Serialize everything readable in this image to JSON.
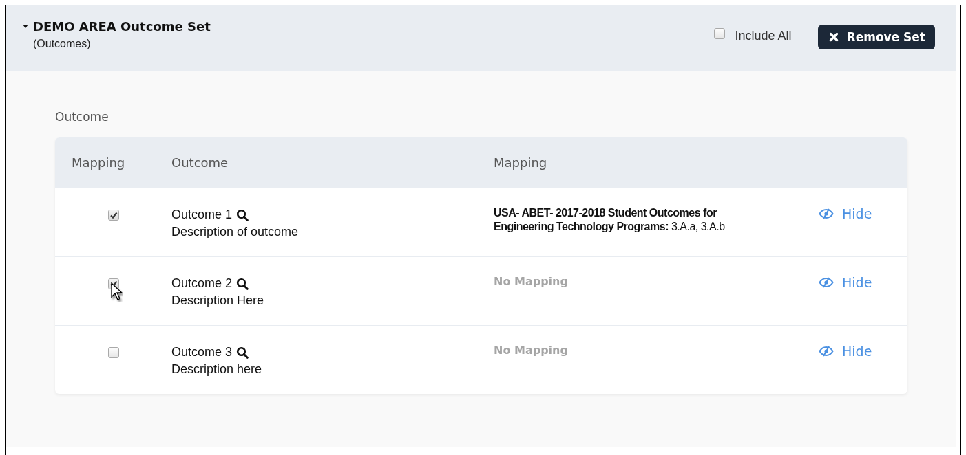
{
  "set": {
    "title": "DEMO AREA Outcome Set",
    "subtitle": "(Outcomes)",
    "expanded": true,
    "include_all": {
      "label": "Include All",
      "checked": false
    },
    "remove_button": "Remove Set"
  },
  "section_label": "Outcome",
  "table": {
    "columns": [
      "Mapping",
      "Outcome",
      "Mapping"
    ],
    "rows": [
      {
        "checked": true,
        "title": "Outcome 1",
        "description": "Description of outcome",
        "mapping": "**USA- ABET- 2017-2018 Student Outcomes for Engineering Technology Programs:** 3.A.a, 3.A.b",
        "mapped": true,
        "action": "Hide",
        "pointer_over": false
      },
      {
        "checked": true,
        "title": "Outcome 2",
        "description": "Description Here",
        "mapping": "No Mapping",
        "mapped": false,
        "action": "Hide",
        "pointer_over": true
      },
      {
        "checked": false,
        "title": "Outcome 3",
        "description": "Description here",
        "mapping": "No Mapping",
        "mapped": false,
        "action": "Hide",
        "pointer_over": false
      }
    ]
  }
}
